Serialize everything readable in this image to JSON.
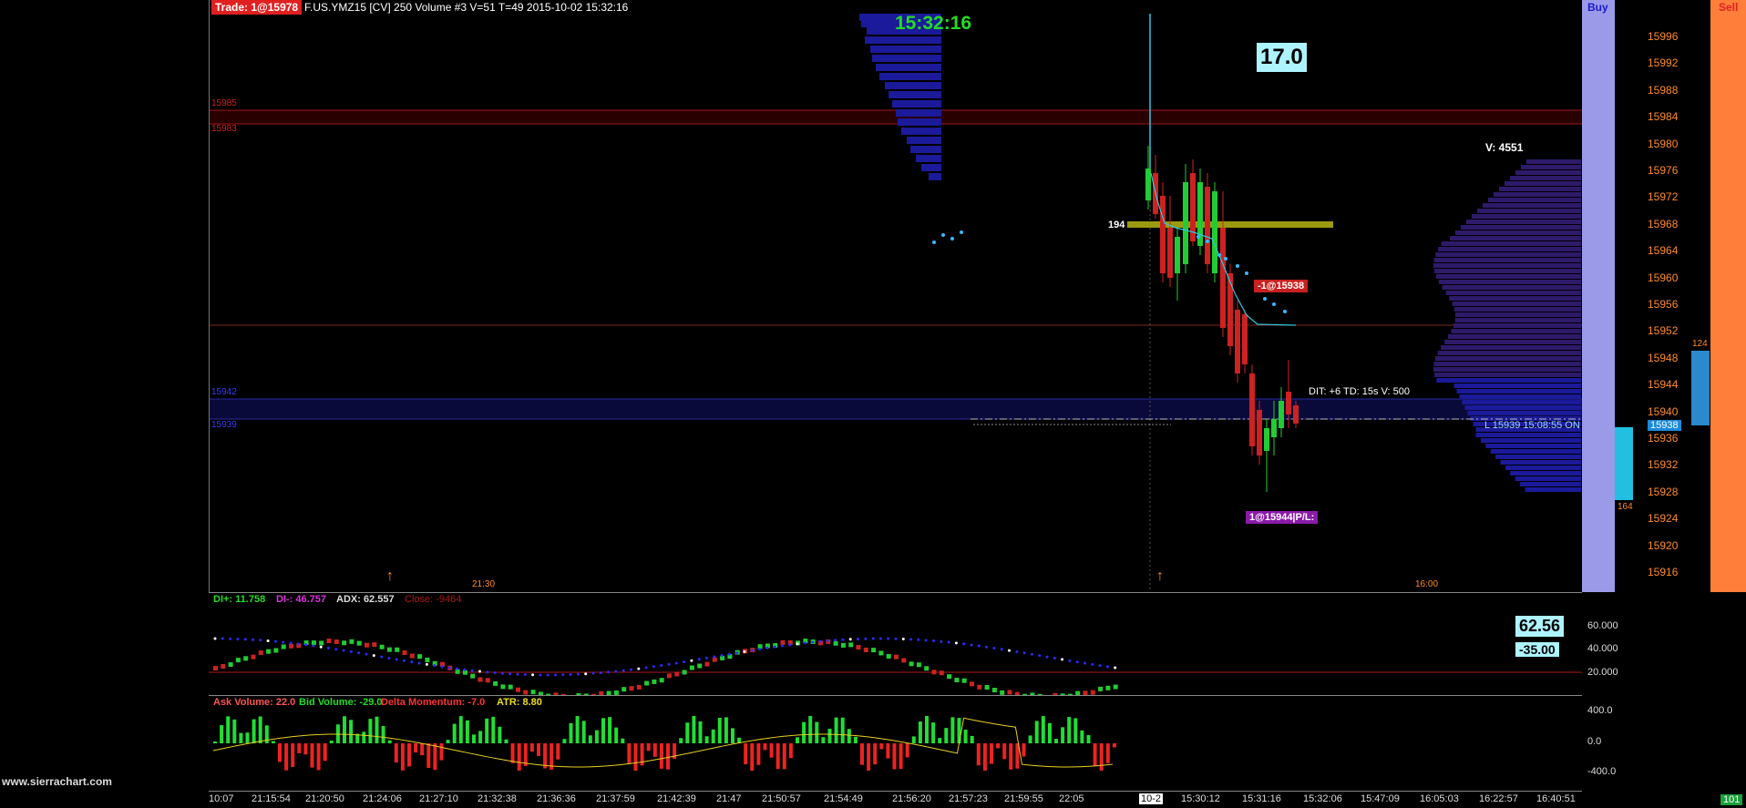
{
  "header": {
    "trade_badge": "Trade: 1@15978",
    "symbol_info": "F.US.YMZ15 [CV]  250 Volume  #3 V=51 T=49 2015-10-02 15:32:16"
  },
  "clock": "15:32:16",
  "big_value": "17.0",
  "order_badge_sell": "-1@15938",
  "order_badge_pos": "1@15944|P/L:",
  "dit_label": "DIT: +6  TD: 15s  V: 500",
  "last_label": "L 15939  15:08:55  ON",
  "volume_label": "V: 4551",
  "level_label": "194",
  "left_levels": [
    "15985",
    "15983",
    "15942",
    "15939"
  ],
  "buy_label": "Buy",
  "sell_label": "Sell",
  "price_axis": [
    "15996",
    "15992",
    "15988",
    "15984",
    "15980",
    "15976",
    "15972",
    "15968",
    "15964",
    "15960",
    "15956",
    "15952",
    "15948",
    "15944",
    "15940",
    "15936",
    "15932",
    "15928",
    "15924",
    "15920",
    "15916"
  ],
  "current_price": "15938",
  "ladder_top": "124",
  "ladder_bottom": "164",
  "time_markers": [
    "21:30",
    "16:00"
  ],
  "time_axis": [
    "10:07",
    "21:15:54",
    "21:20:50",
    "21:24:06",
    "21:27:10",
    "21:32:38",
    "21:36:36",
    "21:37:59",
    "21:42:39",
    "21:47",
    "21:50:57",
    "21:54:49",
    "21:56:20",
    "21:57:23",
    "21:59:55",
    "22:05",
    "10-2",
    "15:30:12",
    "15:31:16",
    "15:32:06",
    "15:47:09",
    "16:05:03",
    "16:22:57",
    "16:40:51"
  ],
  "last_time_badge": "101",
  "watermark": "www.sierrachart.com",
  "adx_panel": {
    "di_plus": "DI+: 11.758",
    "di_minus": "DI-: 46.757",
    "adx": "ADX: 62.557",
    "close": "Close: -9464",
    "badge_top": "62.56",
    "badge_bottom": "-35.00",
    "axis": [
      "60.000",
      "40.000",
      "20.000"
    ]
  },
  "volume_panel": {
    "ask": "Ask Volume: 22.0",
    "bid": "Bid Volume: -29.0",
    "delta": "Delta Momentum: -7.0",
    "atr": "ATR: 8.80",
    "axis": [
      "400.0",
      "0.0",
      "-400.0"
    ]
  },
  "colors": {
    "buy_column": "#9a9ae8",
    "sell_column": "#ff7f3a",
    "up_candle": "#22cc33",
    "down_candle": "#cc2222",
    "profile": "#1a1a9a",
    "clock_green": "#22dd22",
    "axis_orange": "#ff8a2a"
  }
}
